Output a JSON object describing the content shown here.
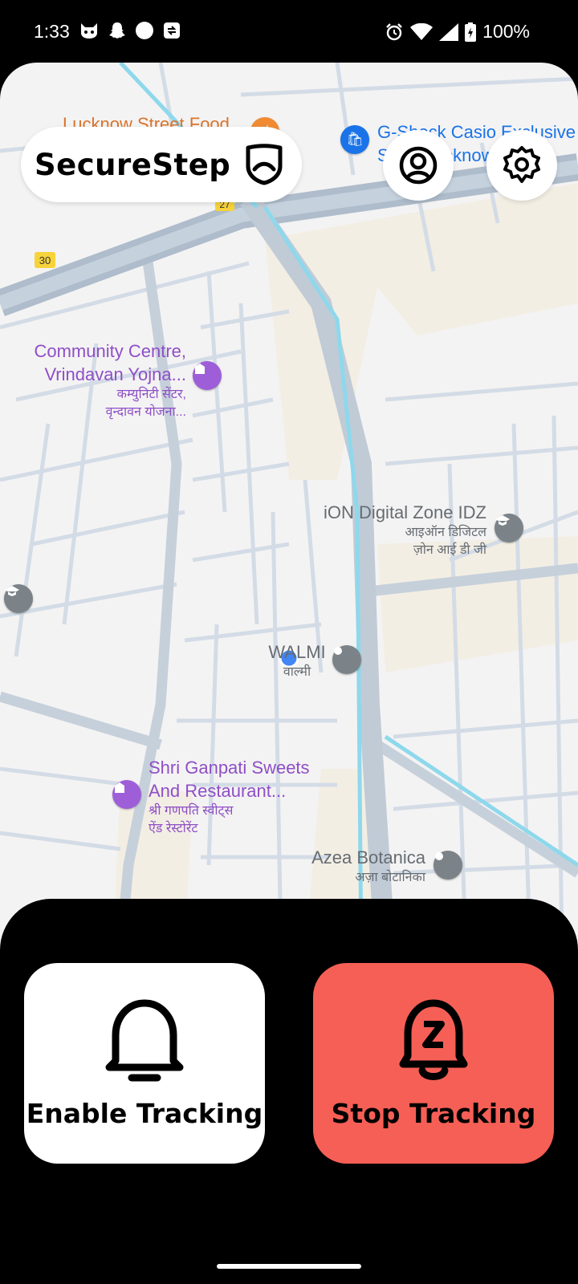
{
  "status_bar": {
    "time": "1:33",
    "battery": "100%"
  },
  "header": {
    "app_name": "SecureStep"
  },
  "map": {
    "pois": {
      "street_food": "Lucknow Street Food",
      "gshock_line1": "G-Shock Casio Exclusive",
      "gshock_line2": "Store Lucknow",
      "community_line1": "Community Centre,",
      "community_line2": "Vrindavan Yojna...",
      "community_hi1": "कम्युनिटी सेंटर,",
      "community_hi2": "वृन्दावन योजना...",
      "ion_name": "iON Digital Zone IDZ",
      "ion_hi1": "आइऑन डिजिटल",
      "ion_hi2": "ज़ोन आई डी जी",
      "walmi_name": "WALMI",
      "walmi_hi": "वाल्मी",
      "ganpati_line1": "Shri Ganpati Sweets",
      "ganpati_line2": "And Restaurant...",
      "ganpati_hi1": "श्री गणपति स्वीट्स",
      "ganpati_hi2": "ऐंड रेस्टोरेंट",
      "azea_name": "Azea Botanica",
      "azea_hi": "अज़ा बोटानिका"
    },
    "road_shields": [
      "27",
      "30"
    ]
  },
  "actions": {
    "enable_label": "Enable Tracking",
    "stop_label": "Stop Tracking"
  },
  "colors": {
    "stop_button": "#f65f55",
    "map_background": "#f4f3f3",
    "poi_purple": "#8e4fc7",
    "location_dot": "#4285f4"
  }
}
